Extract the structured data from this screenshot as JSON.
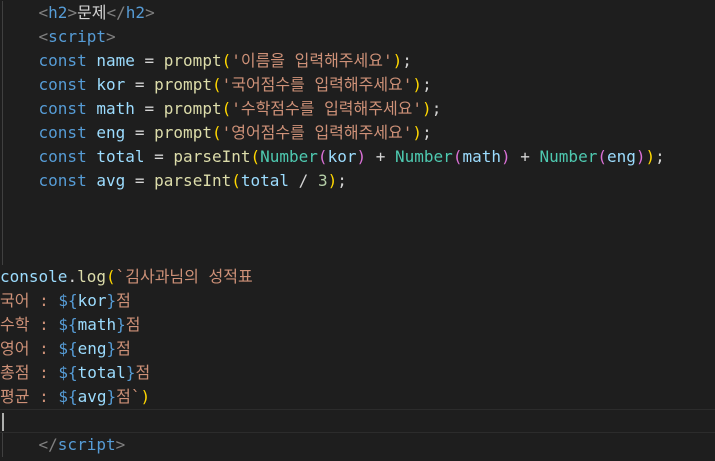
{
  "editor": {
    "html_lines": {
      "h2_tag": "h2",
      "h2_text": "문제",
      "script_tag": "script"
    },
    "code_lines": [
      {
        "var": "name",
        "prompt": "'이름을 입력해주세요'"
      },
      {
        "var": "kor",
        "prompt": "'국어점수를 입력해주세요'"
      },
      {
        "var": "math",
        "prompt": "'수학점수를 입력해주세요'"
      },
      {
        "var": "eng",
        "prompt": "'영어점수를 입력해주세요'"
      }
    ],
    "keywords": {
      "const": "const",
      "prompt": "prompt",
      "parseInt": "parseInt",
      "Number": "Number",
      "console": "console",
      "log": "log"
    },
    "total_line": {
      "var": "total",
      "args": [
        "kor",
        "math",
        "eng"
      ]
    },
    "avg_line": {
      "var": "avg",
      "arg": "total",
      "divisor": "3"
    },
    "template": {
      "title": "김사과님의 성적표",
      "rows": [
        {
          "label": "국어",
          "var": "kor"
        },
        {
          "label": "수학",
          "var": "math"
        },
        {
          "label": "영어",
          "var": "eng"
        },
        {
          "label": "총점",
          "var": "total"
        },
        {
          "label": "평균",
          "var": "avg"
        }
      ],
      "suffix": "점"
    }
  }
}
